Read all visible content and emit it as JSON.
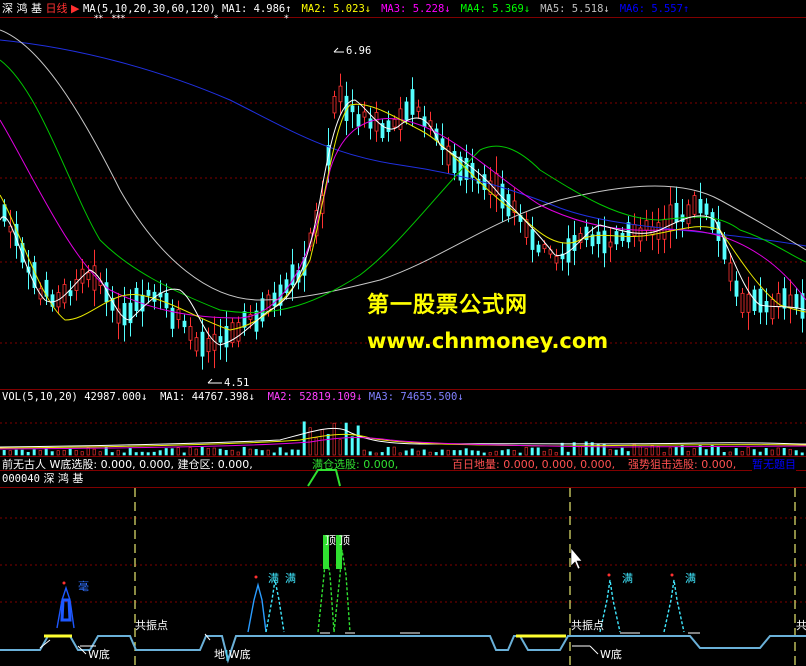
{
  "stock": {
    "name": "深 鸿 基",
    "period": "日线",
    "code": "000040"
  },
  "price_panel": {
    "ma_spec": "MA(5,10,20,30,60,120)",
    "ma": [
      {
        "label": "MA1:",
        "value": "4.986",
        "arrow": "↑",
        "color": "#ffffff"
      },
      {
        "label": "MA2:",
        "value": "5.023",
        "arrow": "↓",
        "color": "#ffff00"
      },
      {
        "label": "MA3:",
        "value": "5.228",
        "arrow": "↓",
        "color": "#ff00ff"
      },
      {
        "label": "MA4:",
        "value": "5.369",
        "arrow": "↓",
        "color": "#00ff00"
      },
      {
        "label": "MA5:",
        "value": "5.518",
        "arrow": "↓",
        "color": "#c0c0c0"
      },
      {
        "label": "MA6:",
        "value": "5.557",
        "arrow": "↑",
        "color": "#0000ff"
      }
    ],
    "high_label": "6.96",
    "low_label": "4.51"
  },
  "volume_panel": {
    "spec": "VOL(5,10,20)",
    "vol": {
      "value": "42987.000",
      "arrow": "↓"
    },
    "ma1": {
      "label": "MA1:",
      "value": "44767.398",
      "arrow": "↓"
    },
    "ma2": {
      "label": "MA2:",
      "value": "52819.109",
      "arrow": "↓"
    },
    "ma3": {
      "label": "MA3:",
      "value": "74655.500",
      "arrow": "↓"
    }
  },
  "indicator_panel": {
    "title": "前无古人",
    "wdi": "W底选股: 0.000, 0.000,",
    "jiancang": "建仓区: 0.000,",
    "mancang": "满仓选股: 0.000,",
    "bairi": "百日地量: 0.000, 0.000, 0.000,",
    "qiangshi": "强势狙击选股: 0.000,",
    "right_tag": "暂无题目",
    "signals": {
      "hao": "毫",
      "man": "满",
      "ding": "顶",
      "gongzhendian": "共振点",
      "wdi_mark": "W底",
      "di_mark": "地"
    }
  },
  "watermark": {
    "line1": "第一股票公式网",
    "line2": "www.chnmoney.com"
  },
  "colors": {
    "bg": "#000000",
    "up": "#ff3232",
    "down": "#54ffff",
    "grid": "#800000"
  }
}
